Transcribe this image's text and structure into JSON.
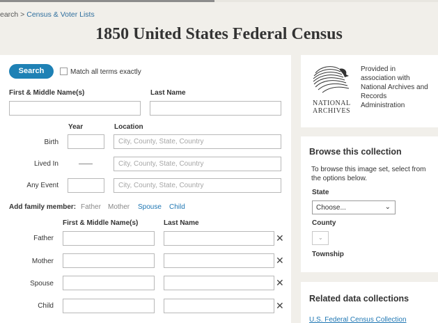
{
  "breadcrumb": {
    "prefix": "earch >",
    "link": "Census & Voter Lists"
  },
  "page_title": "1850 United States Federal Census",
  "search": {
    "button_label": "Search",
    "match_exact_label": "Match all terms exactly",
    "first_middle_label": "First & Middle Name(s)",
    "last_name_label": "Last Name",
    "year_label": "Year",
    "location_label": "Location",
    "location_placeholder": "City, County, State, Country",
    "events": {
      "birth": "Birth",
      "lived_in": "Lived In",
      "any_event": "Any Event"
    },
    "family": {
      "label": "Add family member:",
      "options": [
        "Father",
        "Mother",
        "Spouse",
        "Child"
      ],
      "first_middle_label": "First & Middle Name(s)",
      "last_name_label": "Last Name",
      "rows": [
        "Father",
        "Mother",
        "Spouse",
        "Child"
      ]
    },
    "remove_glyph": "✕"
  },
  "partner": {
    "logo_line1": "NATIONAL",
    "logo_line2": "ARCHIVES",
    "text": [
      "Provided in",
      "association with",
      "National Archives and",
      "Records",
      "Administration"
    ]
  },
  "browse": {
    "title": "Browse this collection",
    "desc": [
      "To browse this image set, select from",
      "the options below."
    ],
    "state_label": "State",
    "state_value": "Choose...",
    "county_label": "County",
    "township_label": "Township"
  },
  "related": {
    "title": "Related data collections",
    "link": "U.S. Federal Census Collection"
  }
}
